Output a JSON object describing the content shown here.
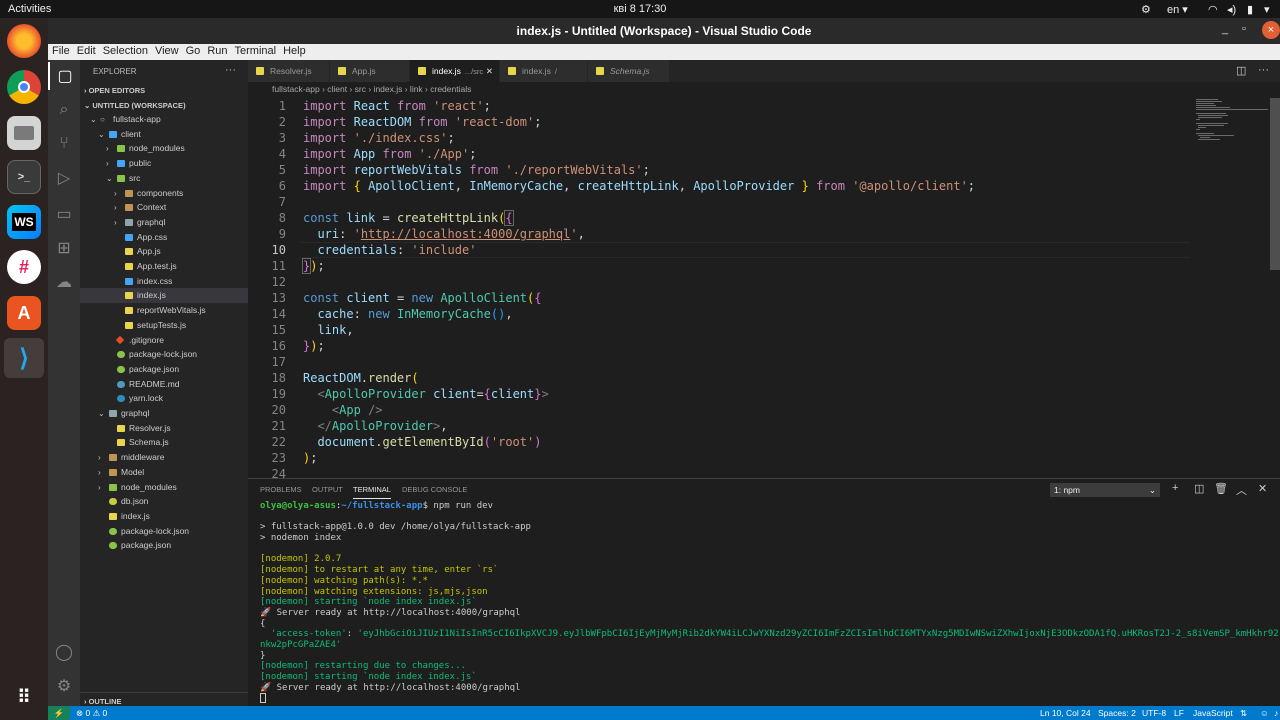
{
  "topbar": {
    "activities": "Activities",
    "clock": "кві 8  17:30",
    "lang": "en"
  },
  "dock": {
    "items": [
      "firefox-icon",
      "chrome-icon",
      "files-icon",
      "terminal-icon",
      "webstorm-icon",
      "slack-icon",
      "software-center-icon",
      "vscode-icon",
      "apps-grid-icon"
    ]
  },
  "window": {
    "title": "index.js - Untitled (Workspace) - Visual Studio Code"
  },
  "menu": [
    "File",
    "Edit",
    "Selection",
    "View",
    "Go",
    "Run",
    "Terminal",
    "Help"
  ],
  "sidebar": {
    "header": "EXPLORER",
    "open_editors": "OPEN EDITORS",
    "workspace": "UNTITLED (WORKSPACE)",
    "outline": "OUTLINE",
    "tree": [
      {
        "label": "fullstack-app",
        "depth": 1,
        "arrow": "open",
        "icon": "none"
      },
      {
        "label": "client",
        "depth": 2,
        "arrow": "open",
        "icon": "fold-b"
      },
      {
        "label": "node_modules",
        "depth": 3,
        "arrow": "closed",
        "icon": "fold-g"
      },
      {
        "label": "public",
        "depth": 3,
        "arrow": "closed",
        "icon": "fold-b"
      },
      {
        "label": "src",
        "depth": 3,
        "arrow": "open",
        "icon": "fold-g"
      },
      {
        "label": "components",
        "depth": 4,
        "arrow": "closed",
        "icon": "fold"
      },
      {
        "label": "Context",
        "depth": 4,
        "arrow": "closed",
        "icon": "fold"
      },
      {
        "label": "graphql",
        "depth": 4,
        "arrow": "closed",
        "icon": "fold-gray"
      },
      {
        "label": "App.css",
        "depth": 4,
        "arrow": "none",
        "icon": "css"
      },
      {
        "label": "App.js",
        "depth": 4,
        "arrow": "none",
        "icon": "js"
      },
      {
        "label": "App.test.js",
        "depth": 4,
        "arrow": "none",
        "icon": "js"
      },
      {
        "label": "index.css",
        "depth": 4,
        "arrow": "none",
        "icon": "css"
      },
      {
        "label": "index.js",
        "depth": 4,
        "arrow": "none",
        "icon": "js",
        "selected": true
      },
      {
        "label": "reportWebVitals.js",
        "depth": 4,
        "arrow": "none",
        "icon": "js"
      },
      {
        "label": "setupTests.js",
        "depth": 4,
        "arrow": "none",
        "icon": "js"
      },
      {
        "label": ".gitignore",
        "depth": 3,
        "arrow": "none",
        "icon": "git"
      },
      {
        "label": "package-lock.json",
        "depth": 3,
        "arrow": "none",
        "icon": "pkg"
      },
      {
        "label": "package.json",
        "depth": 3,
        "arrow": "none",
        "icon": "pkg"
      },
      {
        "label": "README.md",
        "depth": 3,
        "arrow": "none",
        "icon": "md"
      },
      {
        "label": "yarn.lock",
        "depth": 3,
        "arrow": "none",
        "icon": "yarn"
      },
      {
        "label": "graphql",
        "depth": 2,
        "arrow": "open",
        "icon": "fold-gray"
      },
      {
        "label": "Resolver.js",
        "depth": 3,
        "arrow": "none",
        "icon": "js"
      },
      {
        "label": "Schema.js",
        "depth": 3,
        "arrow": "none",
        "icon": "js"
      },
      {
        "label": "middleware",
        "depth": 2,
        "arrow": "closed",
        "icon": "fold"
      },
      {
        "label": "Model",
        "depth": 2,
        "arrow": "closed",
        "icon": "fold"
      },
      {
        "label": "node_modules",
        "depth": 2,
        "arrow": "closed",
        "icon": "fold-g"
      },
      {
        "label": "db.json",
        "depth": 2,
        "arrow": "none",
        "icon": "json"
      },
      {
        "label": "index.js",
        "depth": 2,
        "arrow": "none",
        "icon": "js"
      },
      {
        "label": "package-lock.json",
        "depth": 2,
        "arrow": "none",
        "icon": "pkg"
      },
      {
        "label": "package.json",
        "depth": 2,
        "arrow": "none",
        "icon": "pkg"
      }
    ]
  },
  "tabs": [
    {
      "label": "Resolver.js",
      "desc": ""
    },
    {
      "label": "App.js",
      "desc": ""
    },
    {
      "label": "index.js",
      "desc": ".../src",
      "active": true
    },
    {
      "label": "index.js",
      "desc": "/"
    },
    {
      "label": "Schema.js",
      "desc": ""
    }
  ],
  "breadcrumbs": "fullstack-app  ›  client  ›  src  ›  index.js  ›  link  ›  credentials",
  "editor": {
    "line_numbers": [
      "1",
      "2",
      "3",
      "4",
      "5",
      "6",
      "7",
      "8",
      "9",
      "10",
      "11",
      "12",
      "13",
      "14",
      "15",
      "16",
      "17",
      "18",
      "19",
      "20",
      "21",
      "22",
      "23",
      "24"
    ],
    "current_line": 10
  },
  "panel": {
    "tabs": [
      "PROBLEMS",
      "OUTPUT",
      "TERMINAL",
      "DEBUG CONSOLE"
    ],
    "active_tab": "TERMINAL",
    "terminal_select": "1: npm",
    "prompt_user": "olya@olya-asus",
    "prompt_path": "~/fullstack-app",
    "command": "$ npm run dev",
    "script_line1": "> fullstack-app@1.0.0 dev /home/olya/fullstack-app",
    "script_line2": "> nodemon index",
    "nodemon1": "[nodemon] 2.0.7",
    "nodemon2": "[nodemon] to restart at any time, enter `rs`",
    "nodemon3": "[nodemon] watching path(s): *.*",
    "nodemon4": "[nodemon] watching extensions: js,mjs,json",
    "nodemon5": "[nodemon] starting `node index index.js`",
    "server1": "🚀 Server ready at http://localhost:4000/graphql",
    "brace_open": "{",
    "token_key": "'access-token'",
    "token_value_1": "'eyJhbGciOiJIUzI1NiIsInR5cCI6IkpXVCJ9.eyJlbWFpbCI6IjEyMjMyMjRib2dkYW4iLCJwYXNzd29yZCI6ImFzZCIsImlhdCI6MTYxNzg5MDIwNSwiZXhwIjoxNjE3ODkzODA1fQ.uHKRosT2J-2_s8iVemSP_kmHkhr92",
    "token_value_2": "nkw2pPcGPaZAE4'",
    "brace_close": "}",
    "nodemon6": "[nodemon] restarting due to changes...",
    "nodemon7": "[nodemon] starting `node index index.js`",
    "server2": "🚀 Server ready at http://localhost:4000/graphql"
  },
  "status": {
    "errors": "⊗ 0 ⚠ 0",
    "position": "Ln 10, Col 24",
    "spaces": "Spaces: 2",
    "encoding": "UTF-8",
    "eol": "LF",
    "language": "JavaScript"
  }
}
